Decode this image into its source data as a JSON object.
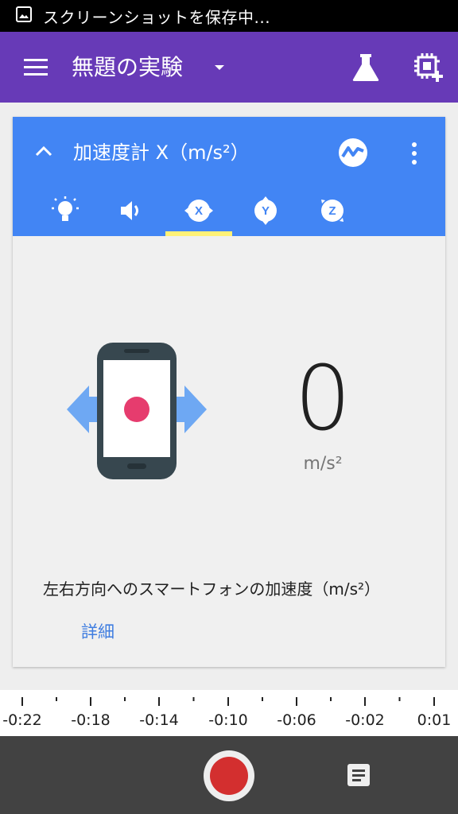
{
  "status_bar": {
    "notification_icon": "image-icon",
    "text": "スクリーンショットを保存中..."
  },
  "app_bar": {
    "menu_icon": "menu-icon",
    "title": "無題の実験",
    "dropdown_icon": "arrow-drop-down-icon",
    "actions": [
      "flask-icon",
      "add-sensor-icon"
    ],
    "color": "#673ab7"
  },
  "sensor_card": {
    "header_color": "#4285f4",
    "collapse_icon": "chevron-up-icon",
    "title": "加速度計 X（m/s²）",
    "graph_toggle_icon": "graph-icon",
    "more_icon": "more-vert-icon",
    "tabs": [
      {
        "icon": "lightbulb-icon",
        "selected": false
      },
      {
        "icon": "volume-icon",
        "selected": false
      },
      {
        "icon": "accel-x-icon",
        "label": "X",
        "selected": true
      },
      {
        "icon": "accel-y-icon",
        "label": "Y",
        "selected": false
      },
      {
        "icon": "accel-z-icon",
        "label": "Z",
        "selected": false
      }
    ],
    "selected_tab_color": "#fff176",
    "illustration": "phone-left-right-icon",
    "value": "0",
    "unit": "m/s²",
    "description": "左右方向へのスマートフォンの加速度（m/s²）",
    "details_link": "詳細"
  },
  "timeline": {
    "labels": [
      "-0:22",
      "-0:18",
      "-0:14",
      "-0:10",
      "-0:06",
      "-0:02",
      "0:01"
    ]
  },
  "bottom_bar": {
    "record_icon": "record-icon",
    "notes_icon": "notes-icon",
    "record_color": "#d32f2f"
  }
}
